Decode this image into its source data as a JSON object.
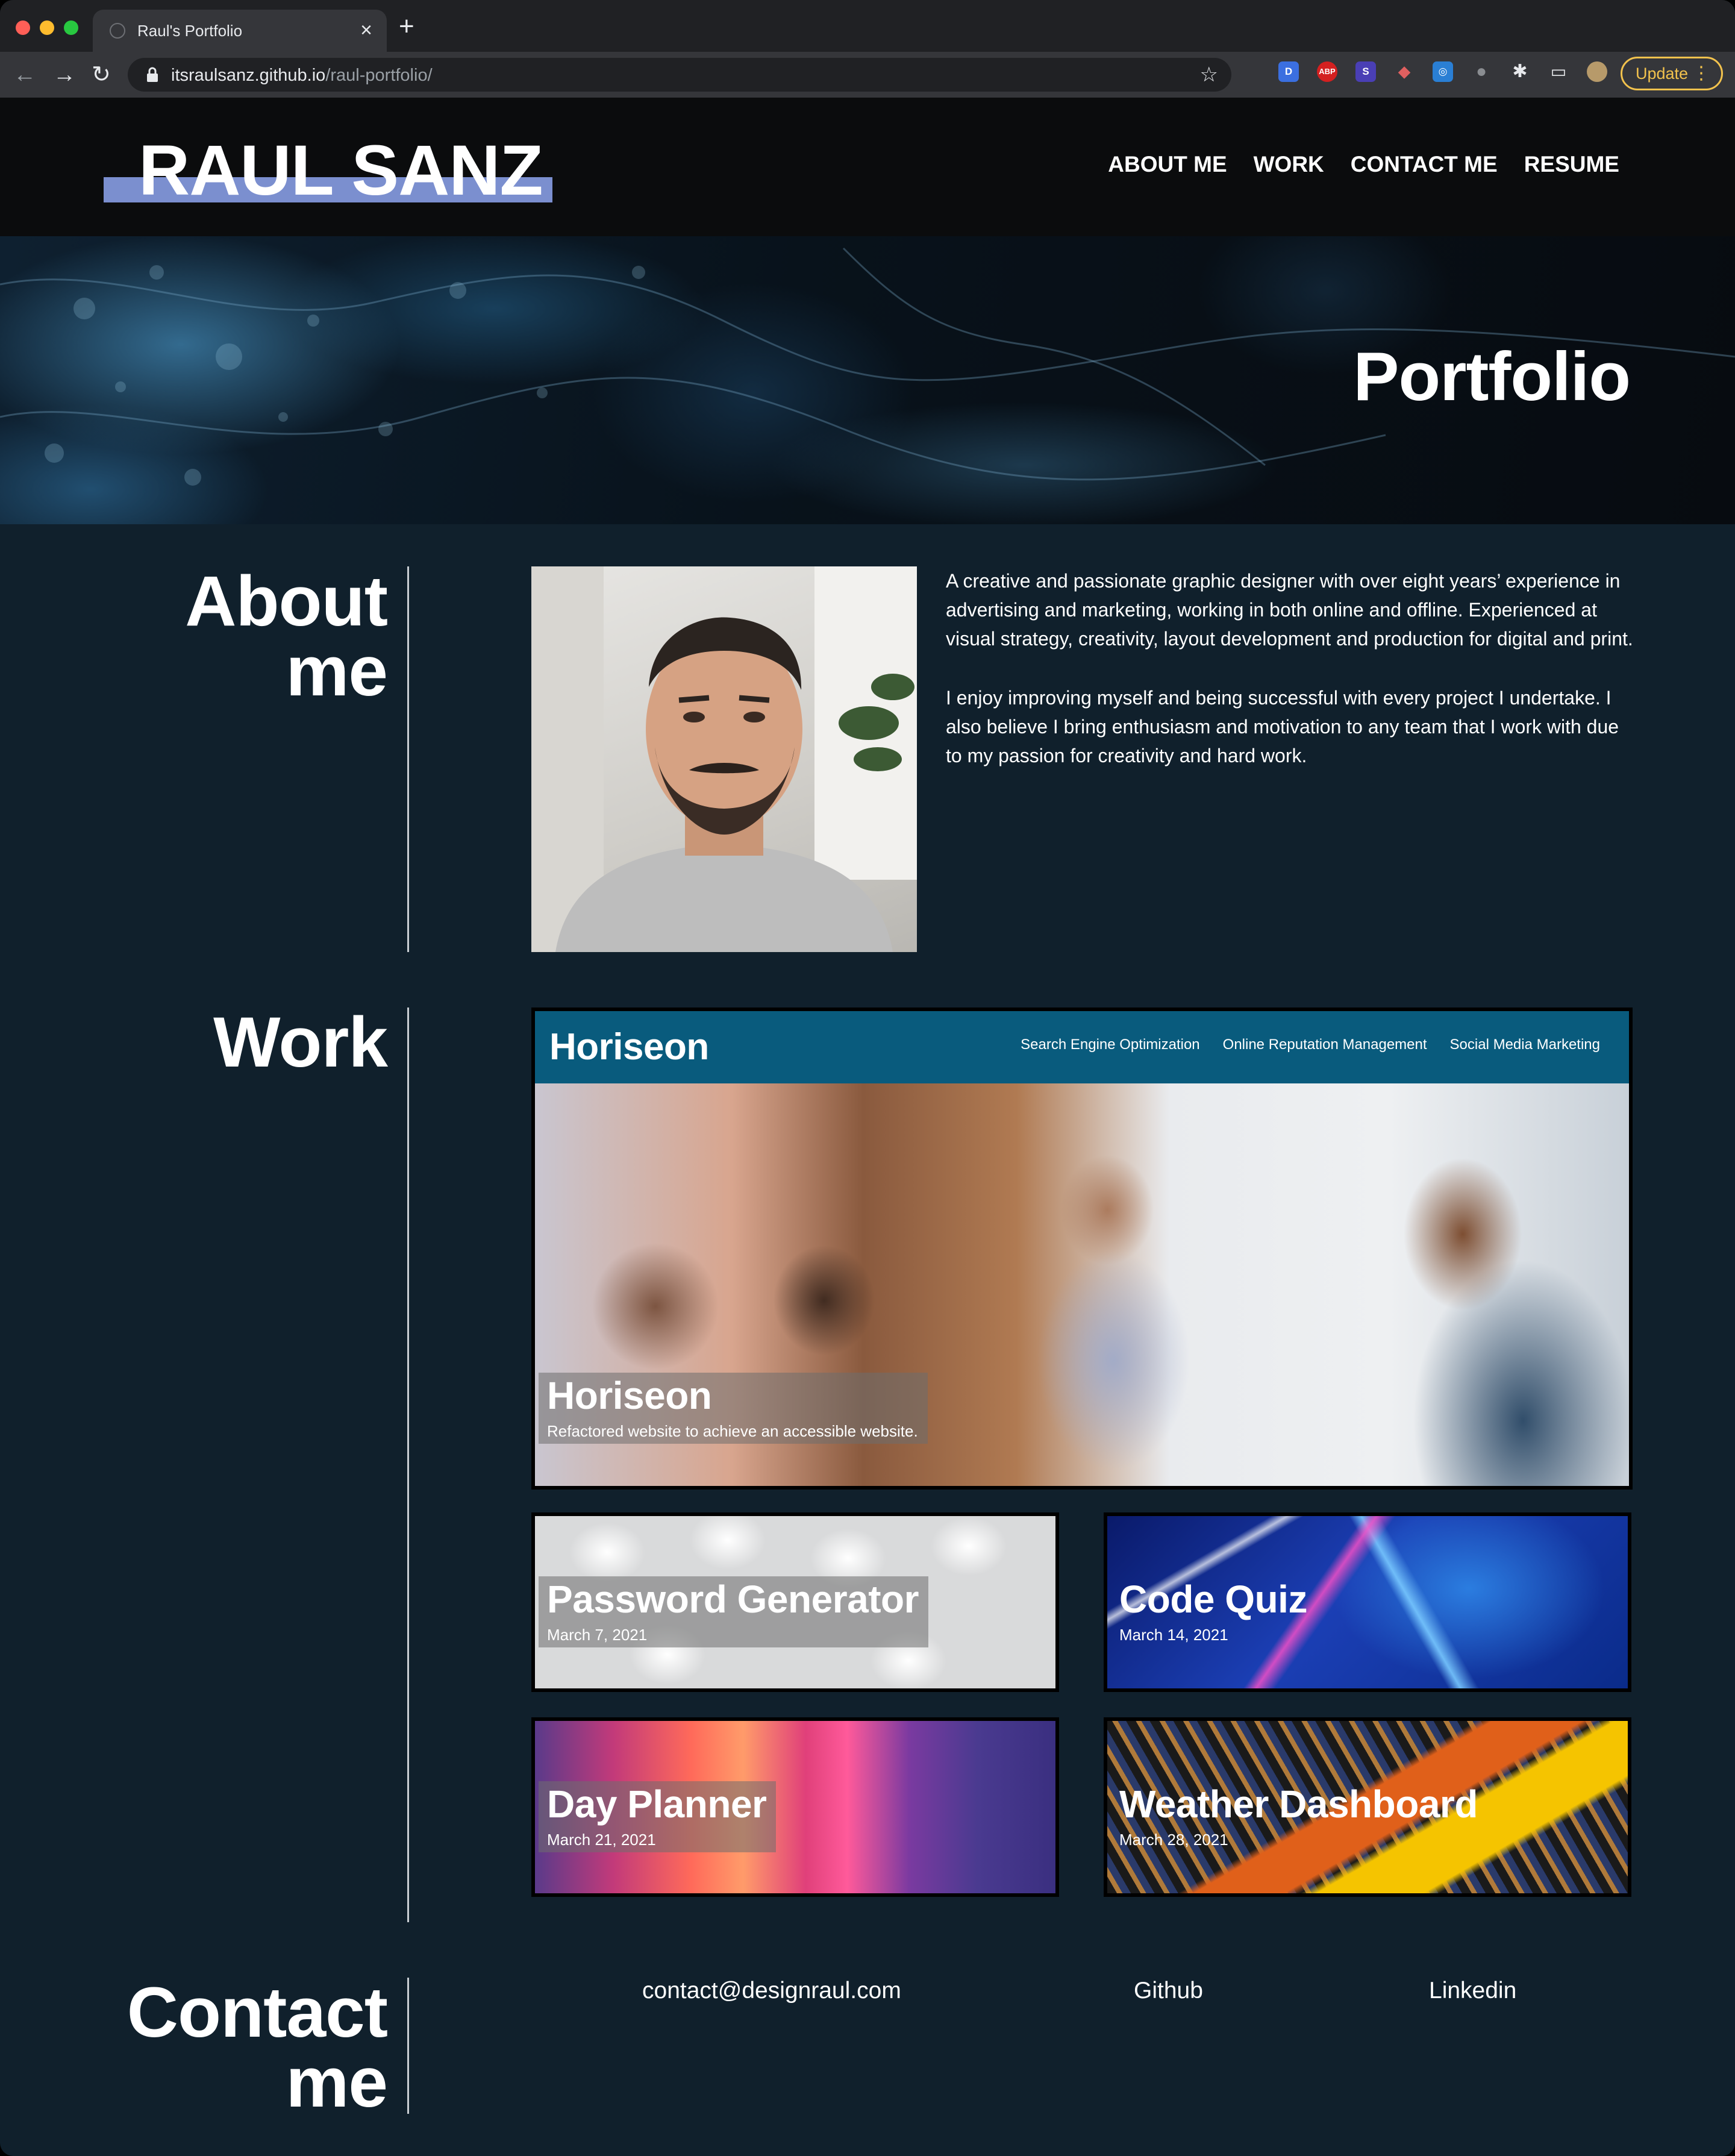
{
  "browser": {
    "tab_title": "Raul's Portfolio",
    "url_host": "itsraulsanz.github.io",
    "url_path": "/raul-portfolio/",
    "update_label": "Update",
    "extensions": [
      "D",
      "ABP",
      "S"
    ]
  },
  "header": {
    "logo": "RAUL SANZ",
    "nav": [
      "ABOUT ME",
      "WORK",
      "CONTACT ME",
      "RESUME"
    ],
    "accent_color": "#7b8fcf"
  },
  "hero": {
    "title": "Portfolio"
  },
  "about": {
    "title_line1": "About",
    "title_line2": "me",
    "paragraphs": [
      "A creative and passionate graphic designer with over eight years’ experience in advertising and marketing, working in both online and offline. Experienced at visual strategy, creativity, layout development and production for digital and print.",
      "I enjoy improving myself and being successful with every project I undertake. I also believe I bring enthusiasm and motivation to any team that I work with due to my passion for creativity and hard work."
    ]
  },
  "work": {
    "title": "Work",
    "featured": {
      "site_logo": "Horiseon",
      "site_nav": [
        "Search Engine Optimization",
        "Online Reputation Management",
        "Social Media Marketing"
      ],
      "title": "Horiseon",
      "subtitle": "Refactored website to achieve an accessible website."
    },
    "projects": [
      {
        "title": "Password Generator",
        "date": "March 7, 2021"
      },
      {
        "title": "Code Quiz",
        "date": "March 14, 2021"
      },
      {
        "title": "Day Planner",
        "date": "March 21, 2021"
      },
      {
        "title": "Weather Dashboard",
        "date": "March 28, 2021"
      }
    ]
  },
  "contact": {
    "title_line1": "Contact",
    "title_line2": "me",
    "email": "contact@designraul.com",
    "github": "Github",
    "linkedin": "Linkedin"
  }
}
